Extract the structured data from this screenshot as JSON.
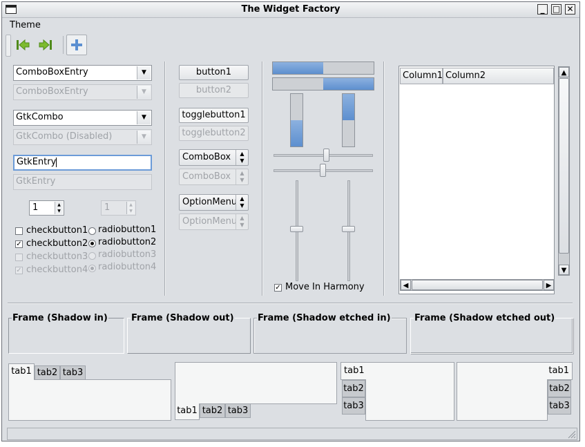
{
  "window": {
    "title": "The Widget Factory"
  },
  "menubar": {
    "items": [
      "Theme"
    ]
  },
  "toolbar": {
    "icons": [
      "go-first-icon",
      "go-last-icon",
      "add-icon"
    ]
  },
  "col1": {
    "combo_entry": {
      "value": "ComboBoxEntry"
    },
    "combo_entry_disabled": {
      "value": "ComboBoxEntry"
    },
    "gtkcombo": {
      "value": "GtkCombo"
    },
    "gtkcombo_disabled": {
      "value": "GtkCombo (Disabled)"
    },
    "entry": {
      "value": "GtkEntry"
    },
    "entry_disabled": {
      "value": "GtkEntry"
    },
    "spin1": {
      "value": "1"
    },
    "spin2": {
      "value": "1"
    },
    "checks": [
      {
        "label": "checkbutton1",
        "checked": false,
        "disabled": false
      },
      {
        "label": "checkbutton2",
        "checked": true,
        "disabled": false
      },
      {
        "label": "checkbutton3",
        "checked": false,
        "disabled": true
      },
      {
        "label": "checkbutton4",
        "checked": true,
        "disabled": true
      }
    ],
    "radios": [
      {
        "label": "radiobutton1",
        "selected": false,
        "disabled": false
      },
      {
        "label": "radiobutton2",
        "selected": true,
        "disabled": false
      },
      {
        "label": "radiobutton3",
        "selected": false,
        "disabled": true
      },
      {
        "label": "radiobutton4",
        "selected": true,
        "disabled": true
      }
    ]
  },
  "col2": {
    "button1": "button1",
    "button2": "button2",
    "toggle1": "togglebutton1",
    "toggle2": "togglebutton2",
    "combobox1": "ComboBox",
    "combobox2": "ComboBox",
    "optionmenu1": "OptionMenu",
    "optionmenu2": "OptionMenu"
  },
  "col3": {
    "hprogress1": 0.5,
    "hprogress2": 0.5,
    "vprogress1": 0.5,
    "vprogress2": 0.5,
    "move_in_harmony": {
      "label": "Move In Harmony",
      "checked": true
    }
  },
  "tree": {
    "columns": [
      "Column1",
      "Column2"
    ]
  },
  "frames": [
    {
      "label": "Frame (Shadow in)"
    },
    {
      "label": "Frame (Shadow out)"
    },
    {
      "label": "Frame (Shadow etched in)"
    },
    {
      "label": "Frame (Shadow etched out)"
    }
  ],
  "notebooks": {
    "tabs": [
      "tab1",
      "tab2",
      "tab3"
    ]
  },
  "colors": {
    "progress_fill": "#6a98d4",
    "background": "#dcdfe3"
  }
}
